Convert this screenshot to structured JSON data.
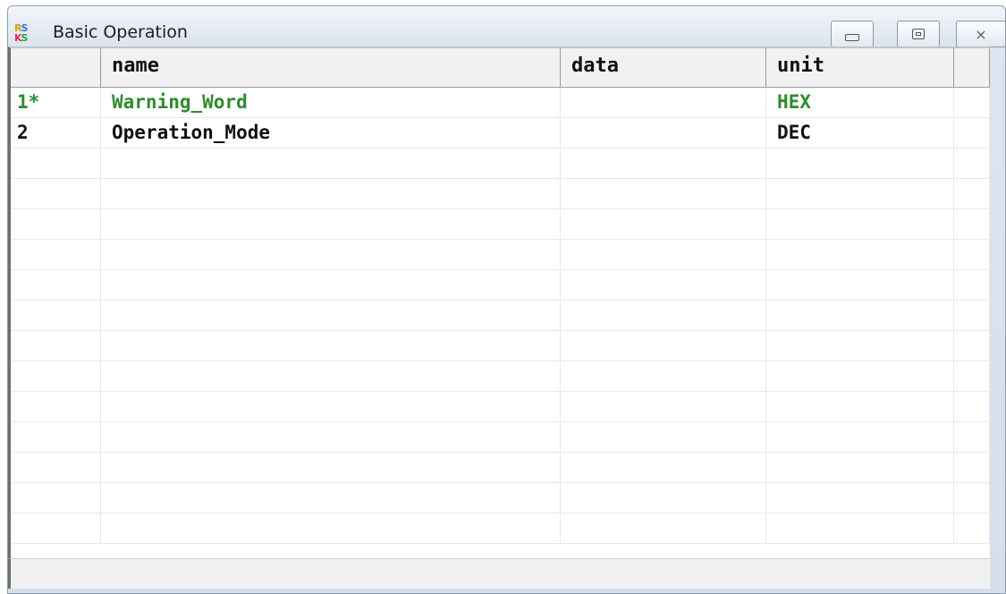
{
  "window": {
    "title": "Basic Operation",
    "icon_letters": [
      "R",
      "S",
      "K",
      "S"
    ]
  },
  "colors": {
    "highlight_text": "#2e8b2e",
    "normal_text": "#111111"
  },
  "table": {
    "columns": [
      "",
      "name",
      "data",
      "unit",
      ""
    ],
    "rows": [
      {
        "index": "1*",
        "name": "Warning_Word",
        "data": "",
        "unit": "HEX",
        "highlight": true
      },
      {
        "index": "2",
        "name": "Operation_Mode",
        "data": "",
        "unit": "DEC",
        "highlight": false
      },
      {
        "index": "",
        "name": "",
        "data": "",
        "unit": "",
        "highlight": false
      },
      {
        "index": "",
        "name": "",
        "data": "",
        "unit": "",
        "highlight": false
      },
      {
        "index": "",
        "name": "",
        "data": "",
        "unit": "",
        "highlight": false
      },
      {
        "index": "",
        "name": "",
        "data": "",
        "unit": "",
        "highlight": false
      },
      {
        "index": "",
        "name": "",
        "data": "",
        "unit": "",
        "highlight": false
      },
      {
        "index": "",
        "name": "",
        "data": "",
        "unit": "",
        "highlight": false
      },
      {
        "index": "",
        "name": "",
        "data": "",
        "unit": "",
        "highlight": false
      },
      {
        "index": "",
        "name": "",
        "data": "",
        "unit": "",
        "highlight": false
      },
      {
        "index": "",
        "name": "",
        "data": "",
        "unit": "",
        "highlight": false
      },
      {
        "index": "",
        "name": "",
        "data": "",
        "unit": "",
        "highlight": false
      },
      {
        "index": "",
        "name": "",
        "data": "",
        "unit": "",
        "highlight": false
      },
      {
        "index": "",
        "name": "",
        "data": "",
        "unit": "",
        "highlight": false
      },
      {
        "index": "",
        "name": "",
        "data": "",
        "unit": "",
        "highlight": false
      }
    ]
  },
  "icons": {
    "app": "app-logo-icon",
    "minimize": "minimize-icon",
    "maximize": "maximize-icon",
    "close": "close-icon"
  }
}
